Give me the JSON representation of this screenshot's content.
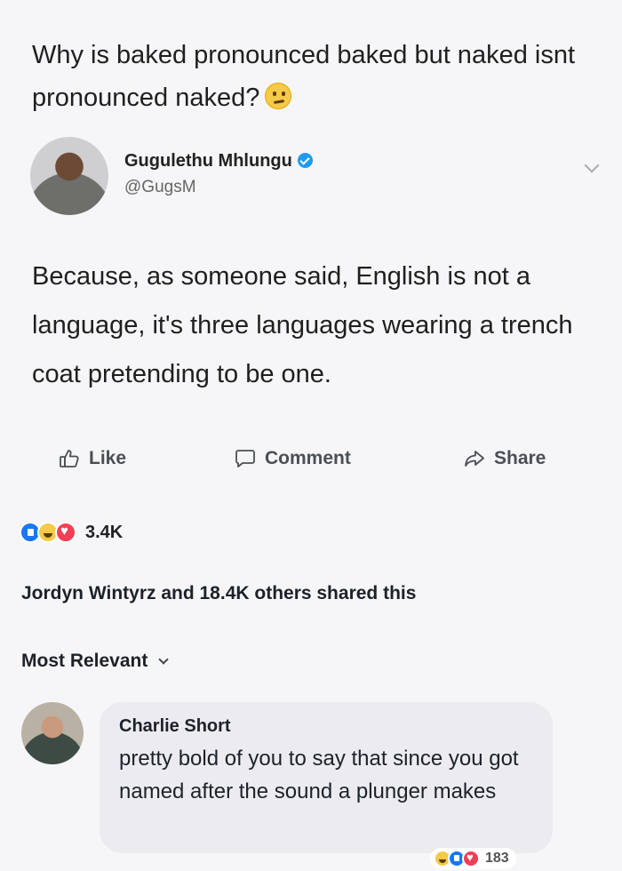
{
  "question": {
    "text": "Why is baked pronounced baked but naked isnt pronounced naked?",
    "emoji": "thinking-face-icon"
  },
  "tweet": {
    "author_name": "Gugulethu Mhlungu",
    "handle": "@GugsM",
    "verified": true,
    "body": "Because, as someone said, English is not a language, it's three languages wearing a trench coat pretending to be one."
  },
  "actions": {
    "like_label": "Like",
    "comment_label": "Comment",
    "share_label": "Share"
  },
  "reactions": {
    "types": [
      "like",
      "haha",
      "love"
    ],
    "count": "3.4K"
  },
  "shared_line": "Jordyn Wintyrz and 18.4K others shared this",
  "sort": {
    "label": "Most Relevant"
  },
  "comment": {
    "author": "Charlie Short",
    "text": "pretty bold of you to say that since you got named after the sound a plunger makes",
    "reactions": [
      "haha",
      "like",
      "love"
    ],
    "reaction_count": "183"
  },
  "colors": {
    "background": "#f6f6f8",
    "verified": "#1d9bf0",
    "like": "#1877f2",
    "love": "#f33e58",
    "haha": "#f7c948",
    "comment_bubble": "#ececf0"
  }
}
